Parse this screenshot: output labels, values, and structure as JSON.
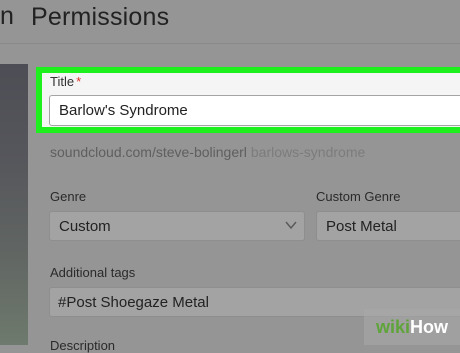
{
  "header": {
    "tab_fragment": "n",
    "title": "Permissions"
  },
  "form": {
    "title_label": "Title",
    "required_mark": "*",
    "title_value": "Barlow's Syndrome",
    "permalink_base": "soundcloud.com/steve-bolingerl",
    "permalink_slug": "barlows-syndrome",
    "genre_label": "Genre",
    "genre_value": "Custom",
    "custom_genre_label": "Custom Genre",
    "custom_genre_value": "Post Metal",
    "tags_label": "Additional tags",
    "tags_value": "#Post Shoegaze Metal",
    "description_label": "Description"
  },
  "watermark": {
    "prefix": "wiki",
    "suffix": "How"
  },
  "colors": {
    "highlight": "#1ef01e",
    "required": "#e0342a"
  }
}
